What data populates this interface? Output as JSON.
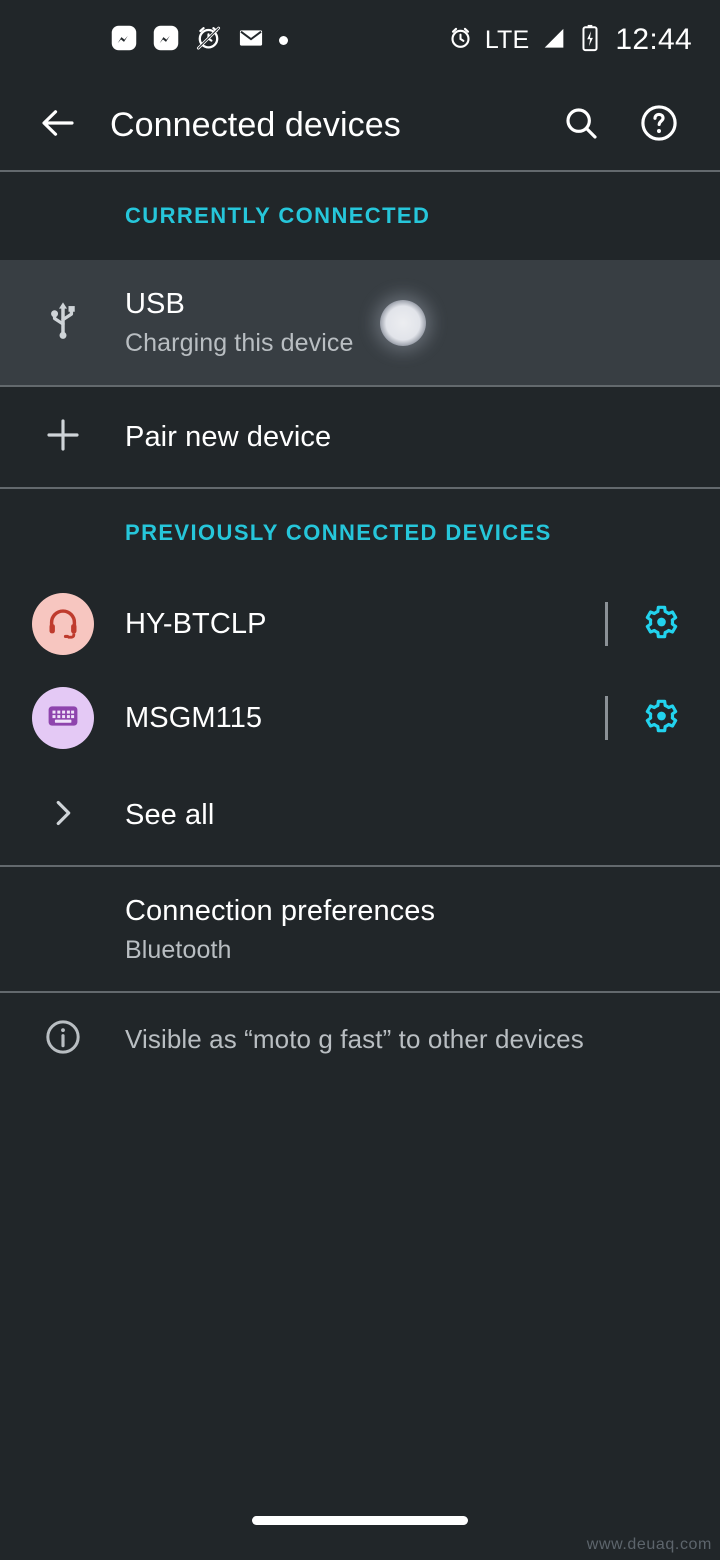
{
  "status_bar": {
    "notification_icons": [
      "messenger-icon",
      "messenger-icon",
      "alarm-off-icon",
      "email-icon",
      "more-notifications-dot-icon"
    ],
    "network_label": "LTE",
    "signal_icon": "signal-bars-icon",
    "alarm_icon": "alarm-clock-icon",
    "battery_icon": "battery-charging-icon",
    "time": "12:44"
  },
  "app_bar": {
    "back_icon": "arrow-back-icon",
    "title": "Connected devices",
    "search_icon": "search-icon",
    "help_icon": "help-circle-icon"
  },
  "sections": {
    "currently_connected": {
      "header": "CURRENTLY CONNECTED",
      "usb": {
        "icon": "usb-icon",
        "title": "USB",
        "subtitle": "Charging this device"
      },
      "pair_new_device": {
        "icon": "plus-icon",
        "title": "Pair new device"
      }
    },
    "previously_connected": {
      "header": "PREVIOUSLY CONNECTED DEVICES",
      "devices": [
        {
          "icon": "headset-icon",
          "name": "HY-BTCLP",
          "settings_icon": "gear-icon"
        },
        {
          "icon": "keyboard-icon",
          "name": "MSGM115",
          "settings_icon": "gear-icon"
        }
      ],
      "see_all": {
        "icon": "chevron-right-icon",
        "title": "See all"
      }
    },
    "connection_preferences": {
      "title": "Connection preferences",
      "subtitle": "Bluetooth"
    },
    "footer_note": {
      "icon": "info-icon",
      "text": "Visible as “moto g fast” to other devices"
    }
  },
  "nav_bar": {
    "home_pill": "home-gesture-pill"
  },
  "watermark": "www.deuaq.com",
  "colors": {
    "background": "#212629",
    "highlight_row": "#383e43",
    "accent_teal": "#26c6da",
    "gear_cyan": "#22d3ee",
    "divider": "#9aa0a6",
    "secondary_text": "#b9bec2",
    "headset_avatar": "#f7c6c0",
    "headset_glyph": "#c0392b",
    "keyboard_avatar": "#e4c9f5",
    "keyboard_glyph": "#8e44ad"
  }
}
